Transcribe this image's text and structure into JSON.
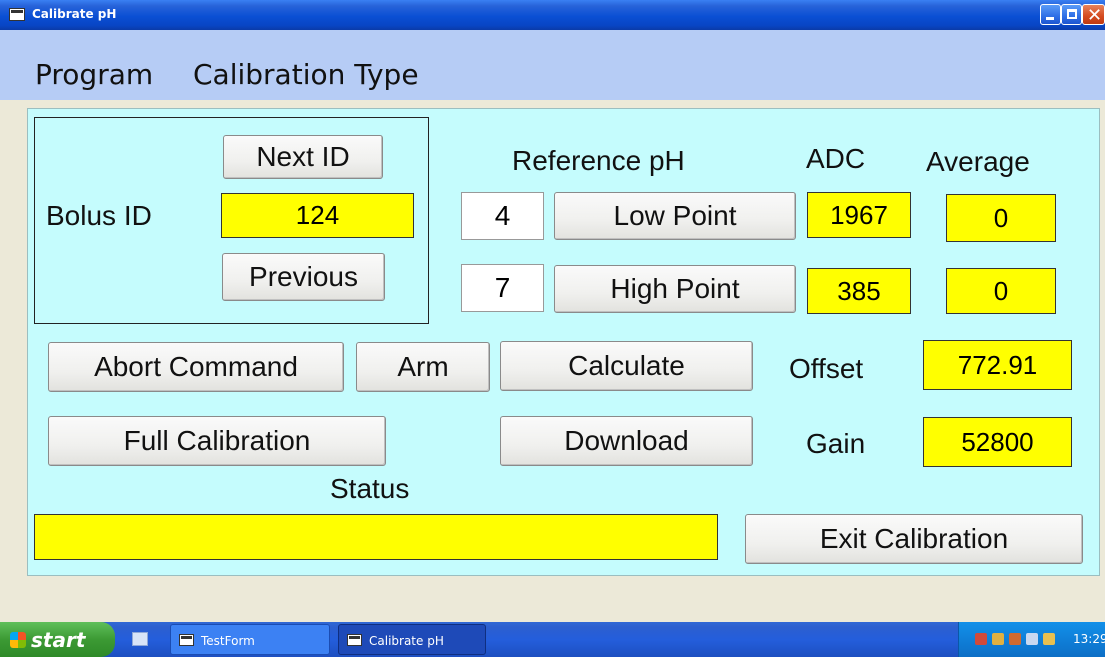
{
  "window": {
    "title": "Calibrate pH"
  },
  "menu": {
    "items": [
      "Program",
      "Calibration Type"
    ]
  },
  "bolus": {
    "label": "Bolus ID",
    "value": "124",
    "next_label": "Next ID",
    "previous_label": "Previous"
  },
  "headers": {
    "reference": "Reference pH",
    "adc": "ADC",
    "average": "Average"
  },
  "low": {
    "ref": "4",
    "button": "Low Point",
    "adc": "1967",
    "average": "0"
  },
  "high": {
    "ref": "7",
    "button": "High Point",
    "adc": "385",
    "average": "0"
  },
  "actions": {
    "abort": "Abort Command",
    "arm": "Arm",
    "calculate": "Calculate",
    "full": "Full Calibration",
    "download": "Download",
    "exit": "Exit Calibration"
  },
  "results": {
    "offset_label": "Offset",
    "offset_value": "772.91",
    "gain_label": "Gain",
    "gain_value": "52800"
  },
  "status": {
    "label": "Status",
    "value": ""
  },
  "taskbar": {
    "start": "start",
    "tasks": [
      "TestForm",
      "Calibrate pH"
    ],
    "clock": "13:29"
  },
  "colors": {
    "panel": "#C5FCFD",
    "field": "#FFFF00",
    "menubar": "#B6CCF5",
    "titlebar": "#0A4FD4"
  }
}
